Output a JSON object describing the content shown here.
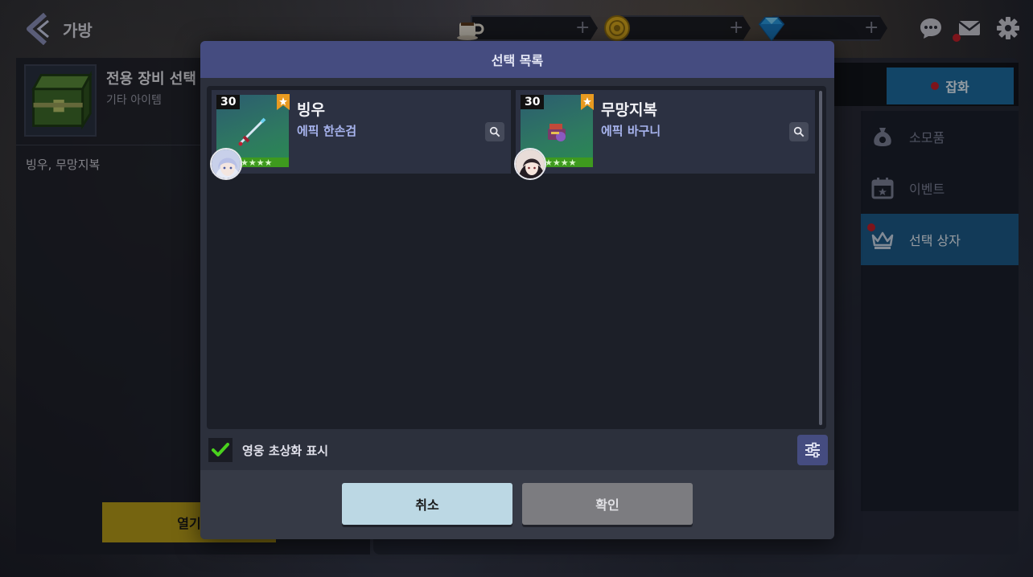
{
  "header": {
    "title": "가방",
    "currencies": [
      {
        "icon": "coffee-icon"
      },
      {
        "icon": "gold-coin-icon"
      },
      {
        "icon": "diamond-icon"
      }
    ],
    "plus": "+"
  },
  "item_panel": {
    "name": "전용 장비 선택",
    "type": "기타 아이템",
    "description": "빙우, 무망지복",
    "open_button": "열기"
  },
  "shop_panel": {
    "goods_tab": "잡화",
    "menu": [
      {
        "label": "소모품",
        "icon": "money-bag-icon",
        "active": false
      },
      {
        "label": "이벤트",
        "icon": "calendar-icon",
        "active": false
      },
      {
        "label": "선택 상자",
        "icon": "crown-icon",
        "active": true
      }
    ]
  },
  "modal": {
    "title": "선택 목록",
    "items": [
      {
        "level": "30",
        "name": "빙우",
        "type": "에픽 한손검",
        "stars": "★★★★"
      },
      {
        "level": "30",
        "name": "무망지복",
        "type": "에픽 바구니",
        "stars": "★★★★"
      }
    ],
    "show_portrait_label": "영웅 초상화 표시",
    "show_portrait_checked": true,
    "cancel_label": "취소",
    "confirm_label": "확인"
  },
  "colors": {
    "modal_header": "#454c80",
    "active_menu": "#1c5a88",
    "cancel": "#bcd8e4",
    "confirm_disabled": "#7c7c80",
    "notification": "#c0202a"
  }
}
